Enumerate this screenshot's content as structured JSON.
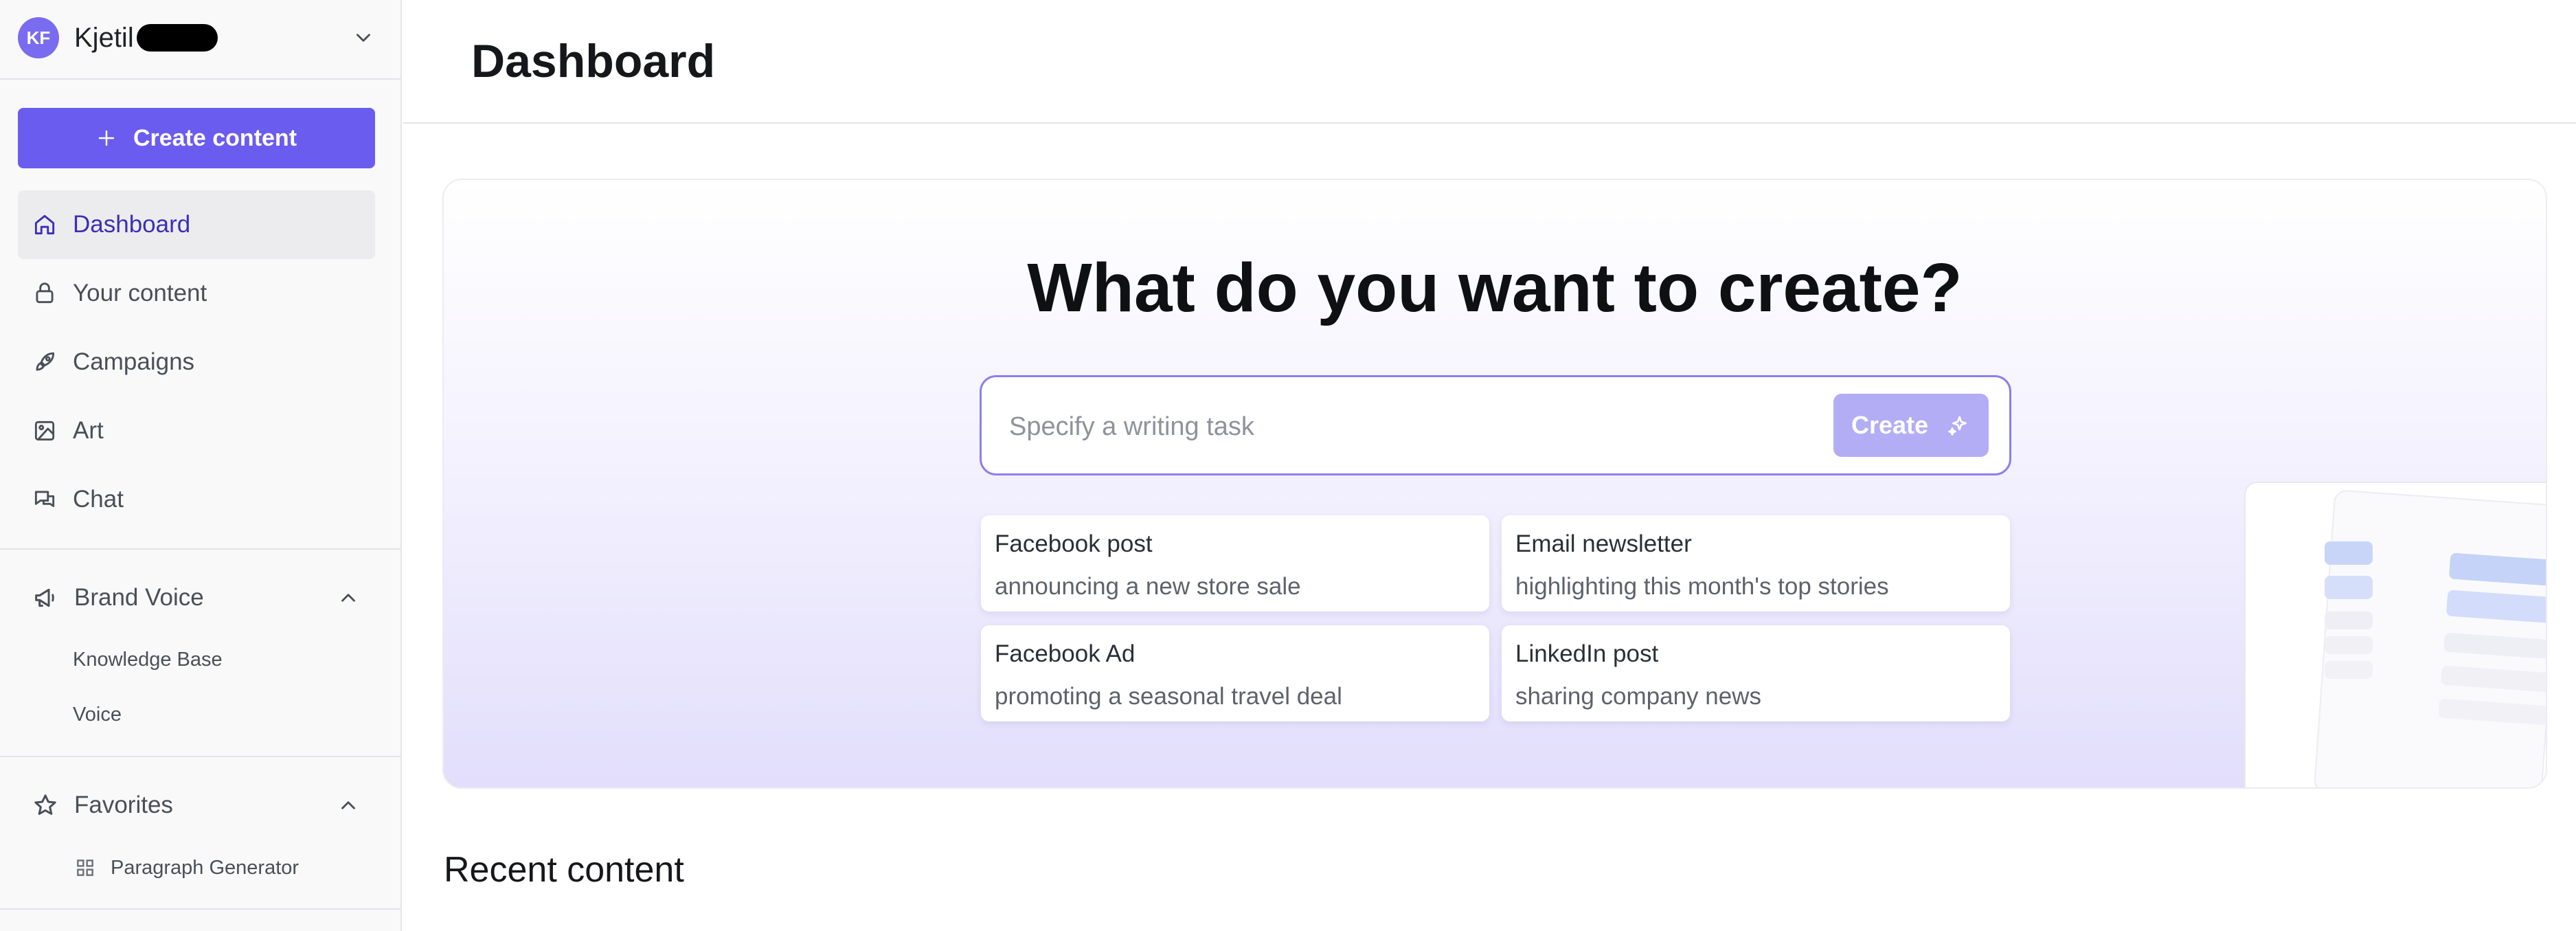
{
  "user": {
    "initials": "KF",
    "name": "Kjetil"
  },
  "sidebar": {
    "create_label": "Create content",
    "nav": [
      {
        "label": "Dashboard",
        "icon": "home-icon",
        "active": true
      },
      {
        "label": "Your content",
        "icon": "lock-icon"
      },
      {
        "label": "Campaigns",
        "icon": "rocket-icon"
      },
      {
        "label": "Art",
        "icon": "image-icon"
      },
      {
        "label": "Chat",
        "icon": "chat-icon"
      }
    ],
    "brand_voice": {
      "label": "Brand Voice",
      "items": [
        "Knowledge Base",
        "Voice"
      ]
    },
    "favorites": {
      "label": "Favorites",
      "items": [
        "Paragraph Generator"
      ]
    }
  },
  "header": {
    "title": "Dashboard"
  },
  "hero": {
    "title": "What do you want to create?",
    "input_placeholder": "Specify a writing task",
    "create_label": "Create",
    "suggestions": [
      {
        "title": "Facebook post",
        "subtitle": "announcing a new store sale"
      },
      {
        "title": "Email newsletter",
        "subtitle": "highlighting this month's top stories"
      },
      {
        "title": "Facebook Ad",
        "subtitle": "promoting a seasonal travel deal"
      },
      {
        "title": "LinkedIn post",
        "subtitle": "sharing company news"
      }
    ]
  },
  "recent": {
    "title": "Recent content"
  },
  "colors": {
    "accent": "#6b5cf0",
    "avatar": "#7a6cf0",
    "active_text": "#3b2fb8",
    "create_disabled": "#b3adf6"
  }
}
